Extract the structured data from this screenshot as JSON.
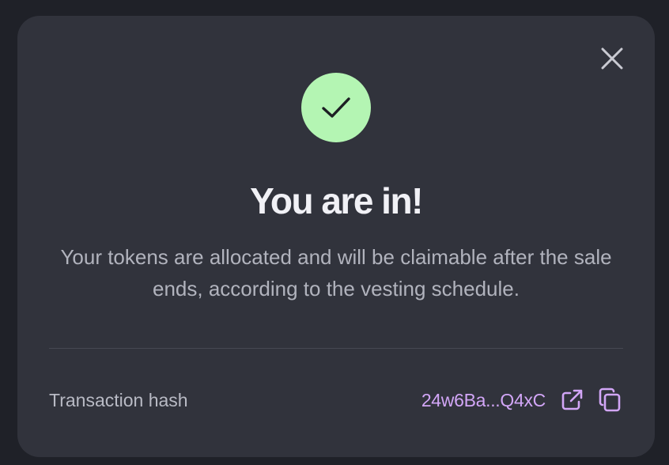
{
  "modal": {
    "title": "You are in!",
    "message": "Your tokens are allocated and will be claimable after the sale ends, according to the vesting schedule.",
    "status_icon": "check-icon",
    "close_icon": "close-icon"
  },
  "transaction": {
    "label": "Transaction hash",
    "hash": "24w6Ba...Q4xC",
    "open_icon": "external-link-icon",
    "copy_icon": "copy-icon"
  },
  "colors": {
    "page_background": "#1f2128",
    "modal_background": "#31333c",
    "success": "#b4f5b3",
    "accent": "#d2a6f7",
    "title_text": "#f1f1f6",
    "muted_text": "#b1b3bd"
  }
}
